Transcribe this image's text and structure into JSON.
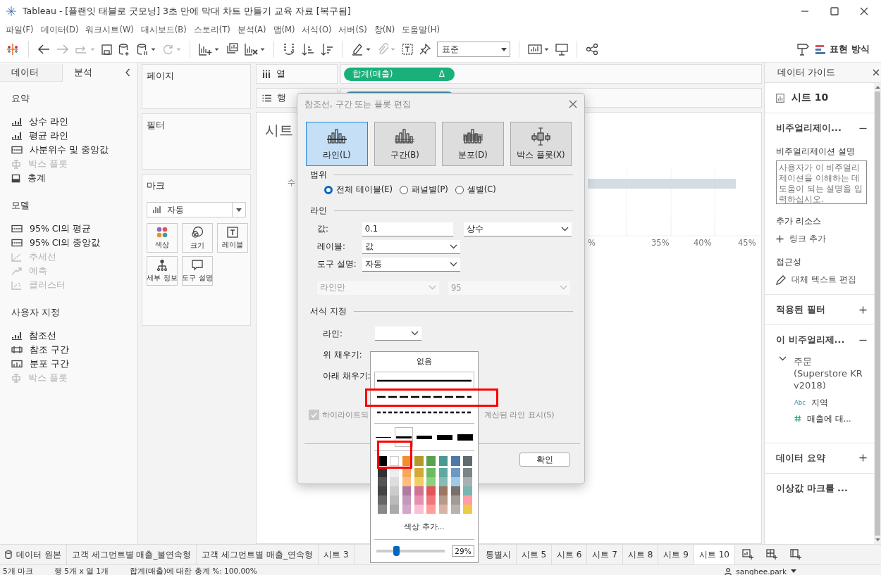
{
  "window": {
    "title": "Tableau - [플랜잇 태블로 굿모닝] 3초 만에 막대 차트 만들기 교육 자료 [복구됨]"
  },
  "menu": [
    "파일(F)",
    "데이터(D)",
    "워크시트(W)",
    "대시보드(B)",
    "스토리(T)",
    "분석(A)",
    "맵(M)",
    "서식(O)",
    "서버(S)",
    "창(N)",
    "도움말(H)"
  ],
  "toolbar": {
    "fit": "표준",
    "show_me": "표현 방식"
  },
  "left_panel": {
    "tabs": [
      {
        "label": "데이터",
        "selected": false
      },
      {
        "label": "분석",
        "selected": true
      }
    ],
    "sections": [
      {
        "title": "요약",
        "items": [
          {
            "label": "상수 라인",
            "kind": "line",
            "disabled": false
          },
          {
            "label": "평균 라인",
            "kind": "line",
            "disabled": false
          },
          {
            "label": "사분위수 및 중앙값",
            "kind": "band",
            "disabled": false
          },
          {
            "label": "박스 플롯",
            "kind": "box",
            "disabled": true
          },
          {
            "label": "총계",
            "kind": "total",
            "disabled": false
          }
        ]
      },
      {
        "title": "모델",
        "items": [
          {
            "label": "95% CI의 평균",
            "kind": "band",
            "disabled": false
          },
          {
            "label": "95% CI의 중앙값",
            "kind": "band",
            "disabled": false
          },
          {
            "label": "추세선",
            "kind": "trend",
            "disabled": true
          },
          {
            "label": "예측",
            "kind": "forecast",
            "disabled": true
          },
          {
            "label": "클러스터",
            "kind": "cluster",
            "disabled": true
          }
        ]
      },
      {
        "title": "사용자 지정",
        "items": [
          {
            "label": "참조선",
            "kind": "line",
            "disabled": false
          },
          {
            "label": "참조 구간",
            "kind": "refband",
            "disabled": false
          },
          {
            "label": "분포 구간",
            "kind": "distribution",
            "disabled": false
          },
          {
            "label": "박스 플롯",
            "kind": "box",
            "disabled": true
          }
        ]
      }
    ]
  },
  "cards": {
    "pages": "페이지",
    "filters": "필터",
    "marks": {
      "title": "마크",
      "type": "자동",
      "buttons": [
        {
          "label": "색상",
          "kind": "color"
        },
        {
          "label": "크기",
          "kind": "size"
        },
        {
          "label": "레이블",
          "kind": "label"
        },
        {
          "label": "세부 정보",
          "kind": "detail"
        },
        {
          "label": "도구 설명",
          "kind": "tooltip"
        }
      ]
    }
  },
  "shelves": {
    "columns": {
      "label": "열",
      "pill": "합계(매출)",
      "pill_mark": "Δ"
    },
    "rows": {
      "label": "행"
    }
  },
  "view": {
    "title": "시트",
    "axis_label": "수",
    "ticks": [
      "%",
      "35%",
      "40%",
      "45%"
    ]
  },
  "dialog": {
    "title": "참조선, 구간 또는 플롯 편집",
    "types": [
      {
        "label": "라인(L)",
        "kind": "line",
        "selected": true
      },
      {
        "label": "구간(B)",
        "kind": "band",
        "selected": false
      },
      {
        "label": "분포(D)",
        "kind": "distribution",
        "selected": false
      },
      {
        "label": "박스 플롯(X)",
        "kind": "box",
        "selected": false
      }
    ],
    "scope_title": "범위",
    "scope": [
      {
        "label": "전체 테이블(E)",
        "selected": true
      },
      {
        "label": "패널별(P)",
        "selected": false
      },
      {
        "label": "셀별(C)",
        "selected": false
      }
    ],
    "line_title": "라인",
    "value_label": "값:",
    "value": "0.1",
    "value_type": "상수",
    "label_label": "레이블:",
    "label_value": "값",
    "tooltip_label": "도구 설명:",
    "tooltip_value": "자동",
    "disabled_fields": [
      "라인만",
      "95"
    ],
    "format_title": "서식 지정",
    "line_label": "라인:",
    "above_fill": "위 채우기:",
    "below_fill": "아래 채우기:",
    "highlight_option": {
      "texts": [
        "하이라이트되",
        "계산된 라인 표시(S)"
      ],
      "checked": true,
      "disabled": true
    },
    "ok": "확인"
  },
  "line_popup": {
    "none": "없음",
    "styles": [
      {
        "kind": "solid",
        "selected": true
      },
      {
        "kind": "dashed",
        "selected": false
      },
      {
        "kind": "dotted",
        "selected": false
      }
    ],
    "style_highlight": true,
    "weights": [
      {
        "selected": false
      },
      {
        "selected": true
      },
      {
        "selected": false
      },
      {
        "selected": false
      },
      {
        "selected": false
      }
    ],
    "swatch_highlight": true,
    "swatch_rows": [
      {
        "swatches": [
          {
            "color": "#000000"
          },
          {
            "color": "#ffffff"
          },
          {
            "color": "#f28e2b"
          },
          {
            "color": "#b6992d"
          },
          {
            "color": "#59a14f"
          },
          {
            "color": "#499894"
          },
          {
            "color": "#4e79a7"
          },
          {
            "color": "#5f6b6d"
          }
        ]
      },
      {
        "swatches": [
          {
            "color": "#333333"
          },
          {
            "color": "#eeeeee"
          },
          {
            "color": "#f9a65a"
          },
          {
            "color": "#d4a937"
          },
          {
            "color": "#6dbb5f"
          },
          {
            "color": "#5fa9a1"
          },
          {
            "color": "#6e98c4"
          },
          {
            "color": "#7b8587"
          }
        ]
      },
      {
        "swatches": [
          {
            "color": "#555555"
          },
          {
            "color": "#dddddd"
          },
          {
            "color": "#ffbe7d"
          },
          {
            "color": "#f1ce63"
          },
          {
            "color": "#8cd17d"
          },
          {
            "color": "#86bcb6"
          },
          {
            "color": "#a0cbe8"
          },
          {
            "color": "#a9b0b2"
          }
        ]
      },
      {
        "swatches": [
          {
            "color": "#444444"
          },
          {
            "color": "#cccccc"
          },
          {
            "color": "#b07aa1"
          },
          {
            "color": "#d37295"
          },
          {
            "color": "#e15759"
          },
          {
            "color": "#9d7660"
          },
          {
            "color": "#79706e"
          },
          {
            "color": "#76b7b2"
          }
        ]
      },
      {
        "swatches": [
          {
            "color": "#666666"
          },
          {
            "color": "#bbbbbb"
          },
          {
            "color": "#c499bd"
          },
          {
            "color": "#e68fb1"
          },
          {
            "color": "#f07779"
          },
          {
            "color": "#b59a8c"
          },
          {
            "color": "#a39b98"
          },
          {
            "color": "#ff9da7"
          }
        ]
      },
      {
        "swatches": [
          {
            "color": "#888888"
          },
          {
            "color": "#aaaaaa"
          },
          {
            "color": "#d4a6c8"
          },
          {
            "color": "#fabfd2"
          },
          {
            "color": "#ff9d9a"
          },
          {
            "color": "#d7b5a6"
          },
          {
            "color": "#bab0ac"
          },
          {
            "color": "#edc948"
          }
        ]
      }
    ],
    "more_colors": "색상 추가...",
    "opacity": {
      "level": 0.29,
      "reading": "29%"
    }
  },
  "data_guide": {
    "title": "데이터 가이드",
    "sheet": "시트 10",
    "viz": {
      "title": "비주얼리제이...",
      "expanded": true
    },
    "description_label": "비주얼리제이션 설명",
    "description_placeholder": "사용자가 이 비주얼리제이션을 이해하는 데 도움이 되는 설명을 입력하십시오.",
    "resources_label": "추가 리소스",
    "add_link": "링크 추가",
    "accessibility_label": "접근성",
    "alt_text": "대체 텍스트 편집",
    "filters": {
      "title": "적용된 필터",
      "expanded": false
    },
    "fields": {
      "title": "이 비주얼리제...",
      "expanded": true,
      "tree": [
        {
          "label": "주문 (Superstore KR v2018)",
          "expanded": true,
          "children": [
            {
              "label": "지역",
              "kind": "dimension",
              "badge": "Abc"
            },
            {
              "label": "매출에 대...",
              "kind": "measure"
            }
          ]
        }
      ]
    },
    "summary": {
      "title": "데이터 요약",
      "expanded": false
    },
    "outliers": {
      "title": "이상값 마크를 ..."
    }
  },
  "sheet_tabs": [
    {
      "label": "데이터 원본",
      "kind": "source",
      "selected": false
    },
    {
      "label": "고객 세그먼트별 매출_불연속형",
      "kind": "sheet",
      "selected": false
    },
    {
      "label": "고객 세그먼트별 매출_연속형",
      "kind": "sheet",
      "selected": false
    },
    {
      "label": "시트 3",
      "kind": "sheet",
      "selected": false
    },
    {
      "label": "통별시",
      "kind": "hidden",
      "selected": false
    },
    {
      "label": "시트 5",
      "kind": "sheet",
      "selected": false
    },
    {
      "label": "시트 6",
      "kind": "sheet",
      "selected": false
    },
    {
      "label": "시트 7",
      "kind": "sheet",
      "selected": false
    },
    {
      "label": "시트 8",
      "kind": "sheet",
      "selected": false
    },
    {
      "label": "시트 9",
      "kind": "sheet",
      "selected": false
    },
    {
      "label": "시트 10",
      "kind": "sheet",
      "selected": true
    }
  ],
  "status_bar": {
    "items": [
      "5개 마크",
      "행 5개 x 열 1개",
      "합계(매출)에 대한 총계 %: 100.00%"
    ],
    "user": "sanghee.park"
  }
}
